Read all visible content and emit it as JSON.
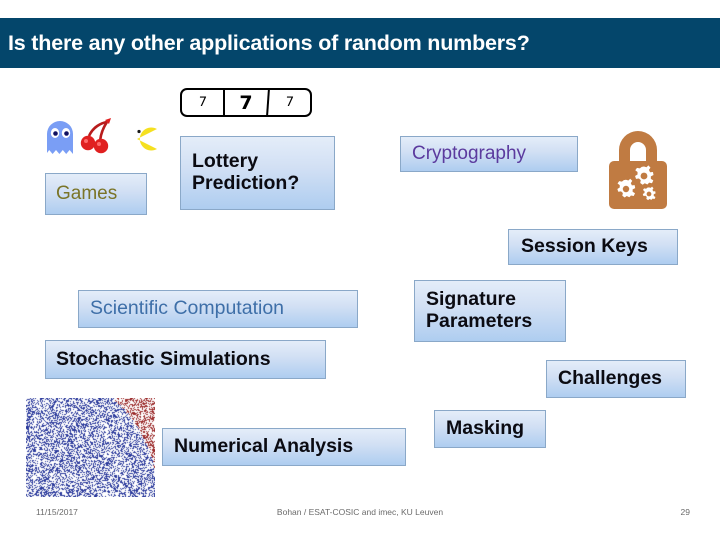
{
  "slide": {
    "title": "Is there any other applications of random numbers?",
    "title_bar_color": "#04466b",
    "background_color": "#ffffff"
  },
  "lottery_display": {
    "name": "slot-machine-777",
    "reels": [
      "7",
      "7",
      "7"
    ]
  },
  "icons": {
    "arcade": {
      "name": "arcade-game-icons",
      "items": [
        "pacman-ghost-icon",
        "cherries-icon",
        "pacman-icon"
      ],
      "ghost_color": "#7a9ef5",
      "cherry_color": "#e02020",
      "pacman_color": "#f5e020"
    },
    "padlock": {
      "name": "padlock-gears-icon",
      "color": "#c07b42",
      "gear_color": "#ffffff"
    },
    "noise": {
      "name": "monte-carlo-scatter-image",
      "inside_color": "#2b3a9c",
      "outside_color": "#9b2b2b"
    }
  },
  "boxes": [
    {
      "id": "games",
      "label": "Games",
      "text_style": "olive"
    },
    {
      "id": "lottery",
      "label": "Lottery\nPrediction?",
      "text_style": "black"
    },
    {
      "id": "crypto",
      "label": "Cryptography",
      "text_style": "purple"
    },
    {
      "id": "session_keys",
      "label": "Session Keys",
      "text_style": "black"
    },
    {
      "id": "scientific",
      "label": "Scientific Computation",
      "text_style": "blue"
    },
    {
      "id": "stochastic",
      "label": "Stochastic Simulations",
      "text_style": "black"
    },
    {
      "id": "signature",
      "label": "Signature\nParameters",
      "text_style": "black"
    },
    {
      "id": "challenges",
      "label": "Challenges",
      "text_style": "black"
    },
    {
      "id": "masking",
      "label": "Masking",
      "text_style": "black"
    },
    {
      "id": "numerical",
      "label": "Numerical Analysis",
      "text_style": "black"
    }
  ],
  "box_labels": {
    "games": "Games",
    "lottery": "Lottery\nPrediction?",
    "crypto": "Cryptography",
    "session_keys": "Session Keys",
    "scientific": "Scientific Computation",
    "stochastic": "Stochastic Simulations",
    "signature": "Signature\nParameters",
    "challenges": "Challenges",
    "masking": "Masking",
    "numerical": "Numerical Analysis"
  },
  "footer": {
    "date": "11/15/2017",
    "center": "Bohan / ESAT-COSIC and imec, KU Leuven",
    "page_number": "29"
  }
}
